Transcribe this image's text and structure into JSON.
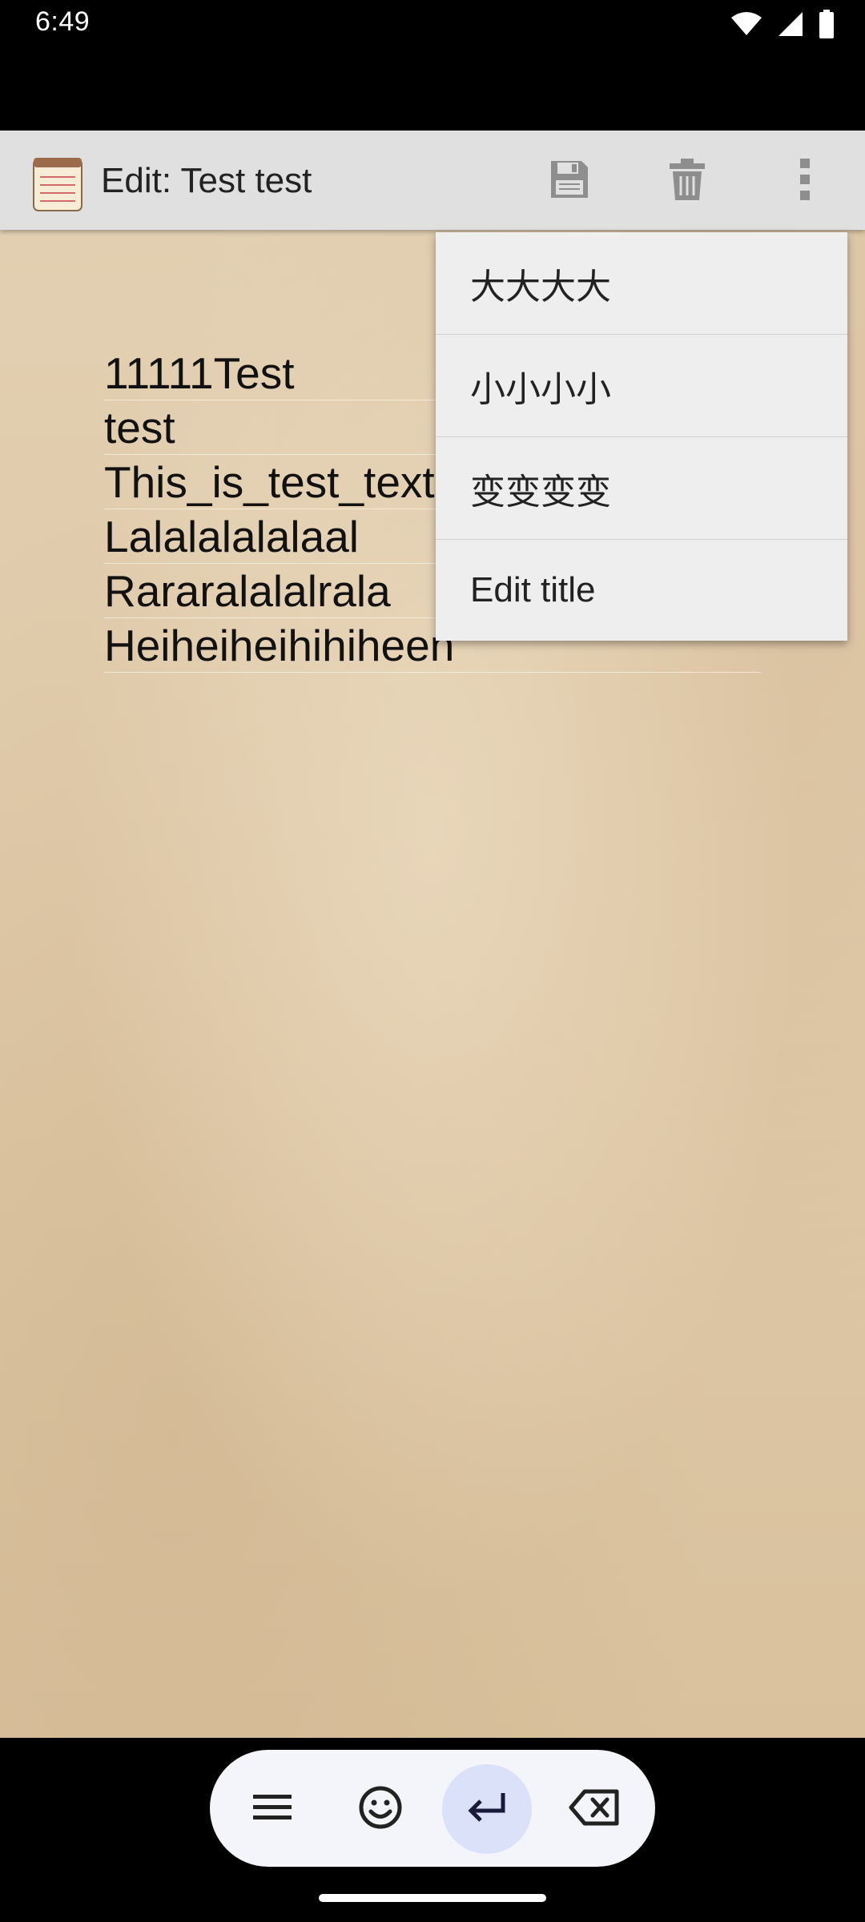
{
  "status": {
    "time": "6:49"
  },
  "app_bar": {
    "title": "Edit: Test test",
    "icons": [
      "notepad-icon",
      "save-icon",
      "delete-icon",
      "more-vert-icon"
    ]
  },
  "note": {
    "lines": [
      "11111Test",
      "test",
      "This_is_test_text",
      "Lalalalalalaal",
      "Rararalalalrala",
      "Heiheiheihihiheen"
    ]
  },
  "menu": {
    "items": [
      "大大大大",
      "小小小小",
      "变变变变",
      "Edit title"
    ]
  },
  "nav": {
    "icons": [
      "menu-icon",
      "emoji-icon",
      "enter-icon",
      "backspace-icon"
    ],
    "accent": "#dbe1f8"
  }
}
